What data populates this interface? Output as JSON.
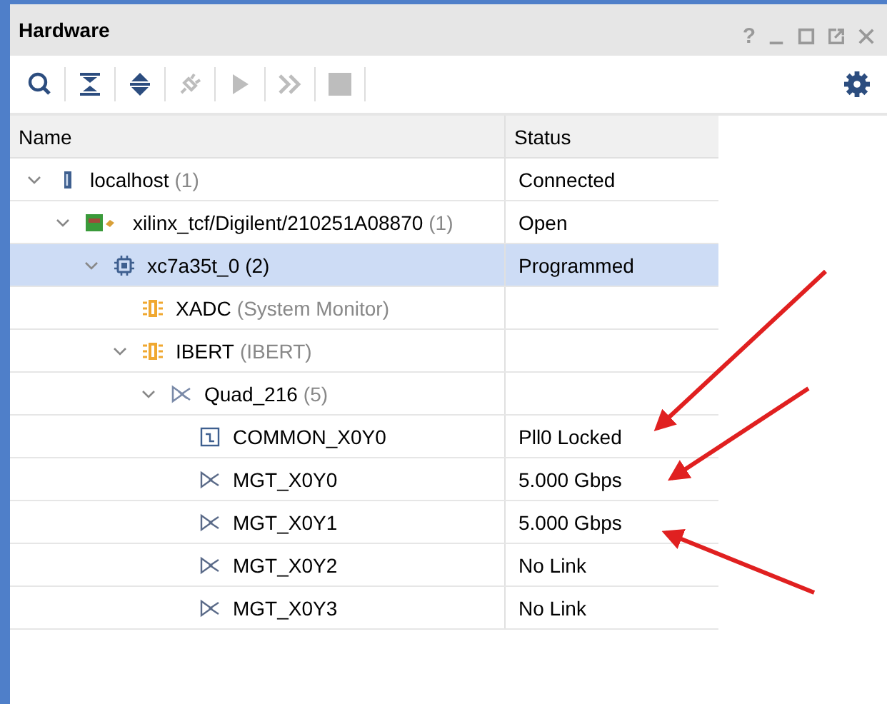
{
  "window": {
    "title": "Hardware",
    "controls": [
      {
        "kind": "help",
        "label": "?"
      },
      {
        "kind": "minimize"
      },
      {
        "kind": "maximize"
      },
      {
        "kind": "float"
      },
      {
        "kind": "close"
      }
    ]
  },
  "toolbar": [
    {
      "kind": "search",
      "disabled": false
    },
    {
      "kind": "collapse",
      "disabled": false
    },
    {
      "kind": "expand",
      "disabled": false
    },
    {
      "kind": "plug",
      "disabled": true
    },
    {
      "kind": "run",
      "disabled": true
    },
    {
      "kind": "skip",
      "disabled": true
    },
    {
      "kind": "stop",
      "disabled": true
    },
    {
      "kind": "settings",
      "disabled": false
    }
  ],
  "table": {
    "columns": [
      "Name",
      "Status"
    ],
    "tree": [
      {
        "kind": "server",
        "name": "localhost",
        "suffix": "(1)",
        "status": "Connected",
        "selected": false,
        "expanded": true,
        "children": [
          {
            "kind": "board",
            "name": "xilinx_tcf/Digilent/210251A08870",
            "suffix": "(1)",
            "status": "Open",
            "selected": false,
            "expanded": true,
            "children": [
              {
                "kind": "chip",
                "name": "xc7a35t_0",
                "suffix": "(2)",
                "status": "Programmed",
                "selected": true,
                "expanded": true,
                "children": [
                  {
                    "kind": "core",
                    "name": "XADC",
                    "suffix": "(System Monitor)",
                    "selected": false
                  },
                  {
                    "kind": "core",
                    "name": "IBERT",
                    "suffix": "(IBERT)",
                    "selected": false,
                    "expanded": true,
                    "children": [
                      {
                        "kind": "quad",
                        "name": "Quad_216",
                        "suffix": "(5)",
                        "selected": false,
                        "expanded": true,
                        "children": [
                          {
                            "kind": "common",
                            "name": "COMMON_X0Y0",
                            "status": "Pll0 Locked",
                            "selected": false
                          },
                          {
                            "kind": "mgt",
                            "name": "MGT_X0Y0",
                            "status": "5.000 Gbps",
                            "selected": false
                          },
                          {
                            "kind": "mgt",
                            "name": "MGT_X0Y1",
                            "status": "5.000 Gbps",
                            "selected": false
                          },
                          {
                            "kind": "mgt",
                            "name": "MGT_X0Y2",
                            "status": "No Link",
                            "selected": false
                          },
                          {
                            "kind": "mgt",
                            "name": "MGT_X0Y3",
                            "status": "No Link",
                            "selected": false
                          }
                        ]
                      }
                    ]
                  }
                ]
              }
            ]
          }
        ]
      }
    ]
  },
  "annotations": [
    {
      "kind": "arrow"
    },
    {
      "kind": "arrow"
    },
    {
      "kind": "arrow"
    }
  ]
}
